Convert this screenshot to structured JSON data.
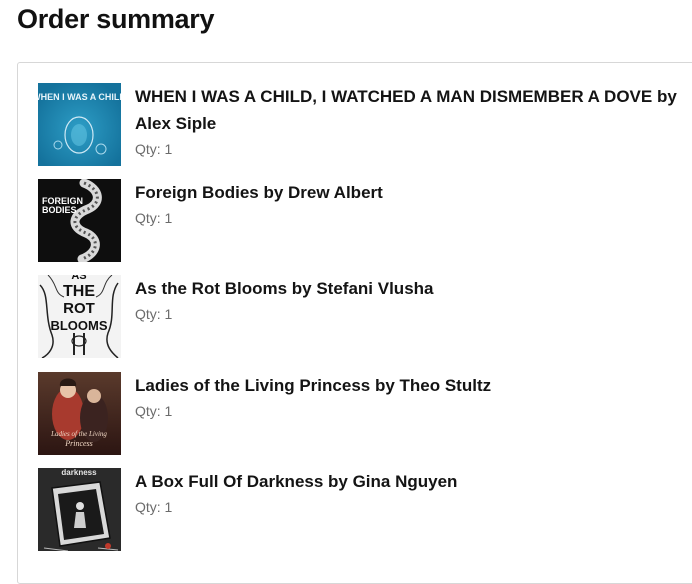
{
  "page": {
    "title": "Order summary"
  },
  "items": [
    {
      "title": "WHEN I WAS A CHILD, I WATCHED A MAN DISMEMBER A DOVE by Alex Siple",
      "qty": "Qty: 1",
      "cover_text": "WHEN I WAS A CHILD",
      "cover_color": "#1f8fb8"
    },
    {
      "title": "Foreign Bodies by Drew Albert",
      "qty": "Qty: 1",
      "cover_text_1": "FOREIGN",
      "cover_text_2": "BODIES",
      "cover_color": "#111111"
    },
    {
      "title": "As the Rot Blooms by Stefani Vlusha",
      "qty": "Qty: 1",
      "cover_text_1": "AS",
      "cover_text_2": "THE",
      "cover_text_3": "ROT",
      "cover_text_4": "BLOOMS",
      "cover_color": "#f4f4f4"
    },
    {
      "title": "Ladies of the Living Princess by Theo Stultz",
      "qty": "Qty: 1",
      "cover_text_1": "Ladies of the Living",
      "cover_text_2": "Princess",
      "cover_color": "#7a2a24"
    },
    {
      "title": "A Box Full Of Darkness by Gina Nguyen",
      "qty": "Qty: 1",
      "cover_text": "darkness",
      "cover_color": "#2a2a2a"
    }
  ]
}
